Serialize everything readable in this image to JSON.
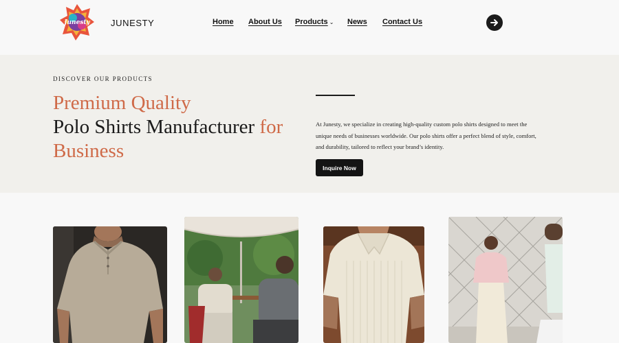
{
  "header": {
    "brand": "JUNESTY",
    "logo_text": "Junesty",
    "nav": [
      {
        "label": "Home"
      },
      {
        "label": "About Us"
      },
      {
        "label": "Products"
      },
      {
        "label": "News"
      },
      {
        "label": "Contact Us"
      }
    ],
    "products_caret": "⌄",
    "cta_icon": "arrow-right-circle-icon"
  },
  "hero": {
    "eyebrow": "DISCOVER OUR PRODUCTS",
    "headline_line1": "Premium Quality",
    "headline_line2": "Polo Shirts Manufacturer ",
    "headline_for": "for",
    "headline_line3": "Business",
    "description": "At Junesty, we specialize in creating high-quality custom polo shirts designed to meet the unique needs of businesses worldwide. Our polo shirts offer a perfect blend of style, comfort, and durability, tailored to reflect your brand’s identity.",
    "button_label": "Inquire Now"
  },
  "colors": {
    "accent": "#cf6a48",
    "hero_bg": "#f1f0ec",
    "page_bg": "#f8f8f8",
    "button_bg": "#141414"
  },
  "products": [
    {
      "image": "man-in-beige-henley-polo"
    },
    {
      "image": "men-at-cafe-under-umbrella"
    },
    {
      "image": "man-in-cream-knit-polo"
    },
    {
      "image": "people-in-pink-polo-by-fence"
    }
  ]
}
